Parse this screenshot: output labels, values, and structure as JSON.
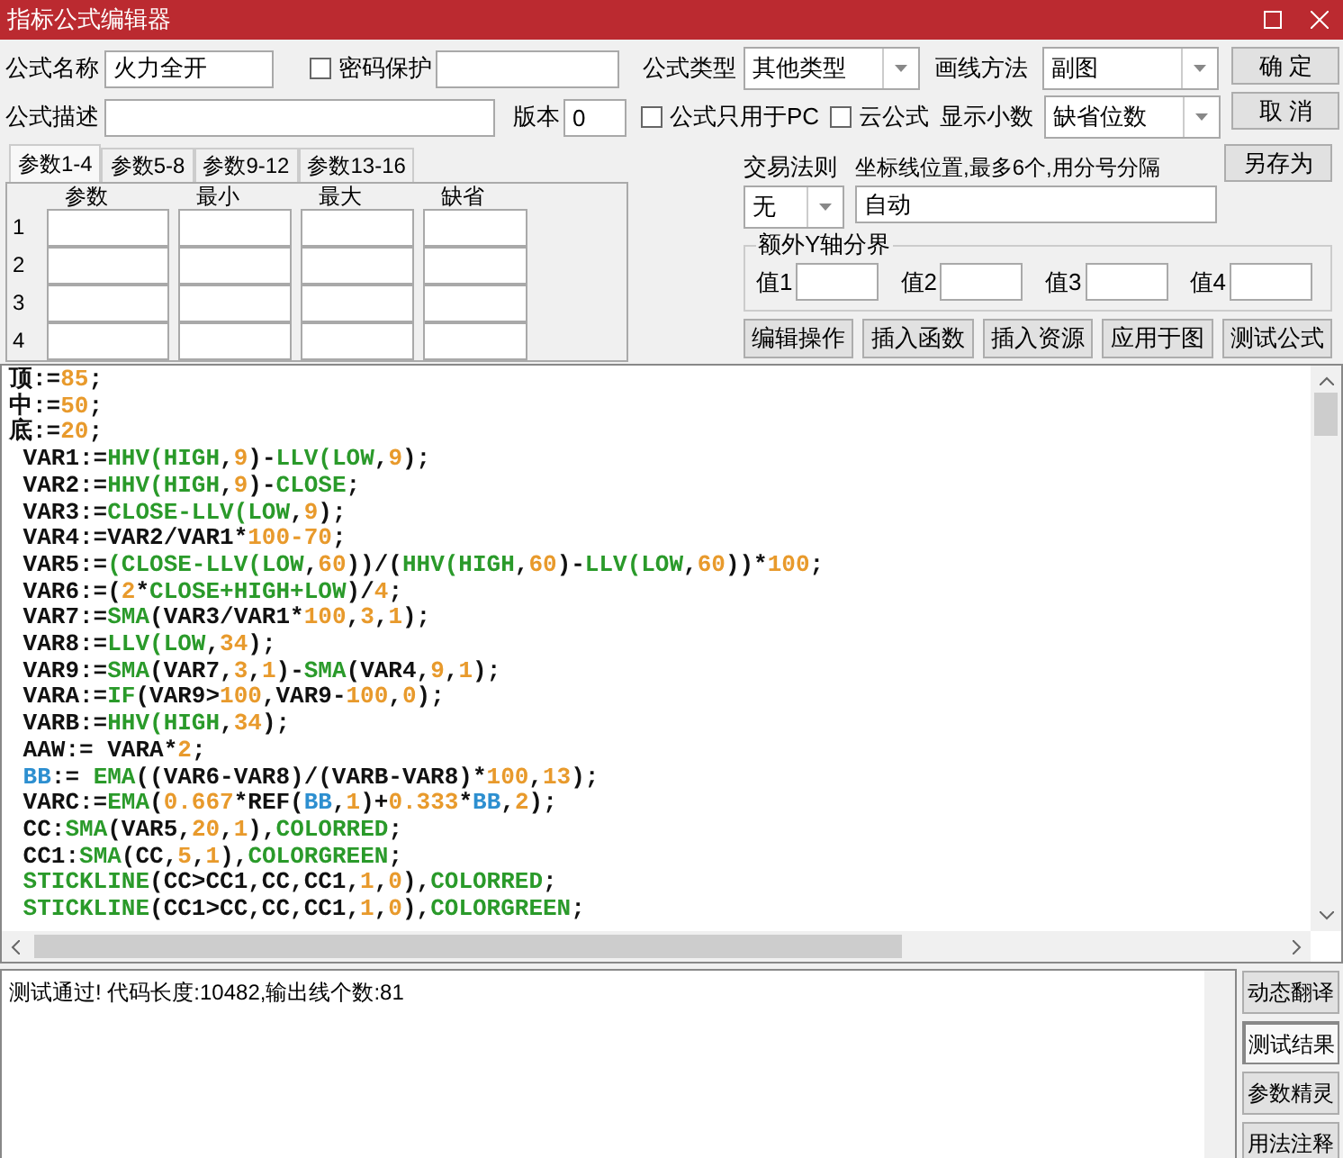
{
  "window": {
    "title": "指标公式编辑器"
  },
  "form": {
    "name_label": "公式名称",
    "name_value": "火力全开",
    "password": {
      "label": "密码保护",
      "checked": false
    },
    "type_label": "公式类型",
    "type_value": "其他类型",
    "draw_label": "画线方法",
    "draw_value": "副图",
    "desc_label": "公式描述",
    "version_label": "版本",
    "version_value": "0",
    "pc_only": {
      "label": "公式只用于PC",
      "checked": false
    },
    "cloud": {
      "label": "云公式",
      "checked": false
    },
    "decimals_label": "显示小数",
    "decimals_value": "缺省位数"
  },
  "buttons_right": [
    "确  定",
    "取  消",
    "另存为"
  ],
  "param_tabs": [
    {
      "label": "参数1-4",
      "selected": true
    },
    {
      "label": "参数5-8",
      "selected": false
    },
    {
      "label": "参数9-12",
      "selected": false
    },
    {
      "label": "参数13-16",
      "selected": false
    }
  ],
  "param_table": {
    "columns": [
      "参数",
      "最小",
      "最大",
      "缺省"
    ],
    "rows": [
      "1",
      "2",
      "3",
      "4"
    ]
  },
  "trade_rule": {
    "label": "交易法则",
    "value": "无"
  },
  "axis_lines": {
    "label": "坐标线位置,最多6个,用分号分隔",
    "value": "自动"
  },
  "extra_y": {
    "title": "额外Y轴分界",
    "fields": [
      "值1",
      "值2",
      "值3",
      "值4"
    ]
  },
  "action_buttons": [
    "编辑操作",
    "插入函数",
    "插入资源",
    "应用于图",
    "测试公式"
  ],
  "code_lines": [
    [
      {
        "kind": "plain",
        "text": "顶:="
      },
      {
        "kind": "num",
        "text": "85"
      },
      {
        "kind": "plain",
        "text": ";"
      }
    ],
    [
      {
        "kind": "plain",
        "text": "中:="
      },
      {
        "kind": "num",
        "text": "50"
      },
      {
        "kind": "plain",
        "text": ";"
      }
    ],
    [
      {
        "kind": "plain",
        "text": "底:="
      },
      {
        "kind": "num",
        "text": "20"
      },
      {
        "kind": "plain",
        "text": ";"
      }
    ],
    [
      {
        "kind": "plain",
        "text": " VAR1:="
      },
      {
        "kind": "fn",
        "text": "HHV(HIGH"
      },
      {
        "kind": "plain",
        "text": ","
      },
      {
        "kind": "num",
        "text": "9"
      },
      {
        "kind": "plain",
        "text": ")-"
      },
      {
        "kind": "fn",
        "text": "LLV(LOW"
      },
      {
        "kind": "plain",
        "text": ","
      },
      {
        "kind": "num",
        "text": "9"
      },
      {
        "kind": "plain",
        "text": ");"
      }
    ],
    [
      {
        "kind": "plain",
        "text": " VAR2:="
      },
      {
        "kind": "fn",
        "text": "HHV(HIGH"
      },
      {
        "kind": "plain",
        "text": ","
      },
      {
        "kind": "num",
        "text": "9"
      },
      {
        "kind": "plain",
        "text": ")-"
      },
      {
        "kind": "fn",
        "text": "CLOSE"
      },
      {
        "kind": "plain",
        "text": ";"
      }
    ],
    [
      {
        "kind": "plain",
        "text": " VAR3:="
      },
      {
        "kind": "fn",
        "text": "CLOSE-LLV(LOW"
      },
      {
        "kind": "plain",
        "text": ","
      },
      {
        "kind": "num",
        "text": "9"
      },
      {
        "kind": "plain",
        "text": ");"
      }
    ],
    [
      {
        "kind": "plain",
        "text": " VAR4:=VAR2/VAR1*"
      },
      {
        "kind": "num",
        "text": "100-70"
      },
      {
        "kind": "plain",
        "text": ";"
      }
    ],
    [
      {
        "kind": "plain",
        "text": " VAR5:="
      },
      {
        "kind": "fn",
        "text": "(CLOSE-LLV(LOW"
      },
      {
        "kind": "plain",
        "text": ","
      },
      {
        "kind": "num",
        "text": "60"
      },
      {
        "kind": "plain",
        "text": "))/("
      },
      {
        "kind": "fn",
        "text": "HHV(HIGH"
      },
      {
        "kind": "plain",
        "text": ","
      },
      {
        "kind": "num",
        "text": "60"
      },
      {
        "kind": "plain",
        "text": ")-"
      },
      {
        "kind": "fn",
        "text": "LLV(LOW"
      },
      {
        "kind": "plain",
        "text": ","
      },
      {
        "kind": "num",
        "text": "60"
      },
      {
        "kind": "plain",
        "text": "))*"
      },
      {
        "kind": "num",
        "text": "100"
      },
      {
        "kind": "plain",
        "text": ";"
      }
    ],
    [
      {
        "kind": "plain",
        "text": " VAR6:=("
      },
      {
        "kind": "num",
        "text": "2"
      },
      {
        "kind": "plain",
        "text": "*"
      },
      {
        "kind": "fn",
        "text": "CLOSE+HIGH+LOW"
      },
      {
        "kind": "plain",
        "text": ")/"
      },
      {
        "kind": "num",
        "text": "4"
      },
      {
        "kind": "plain",
        "text": ";"
      }
    ],
    [
      {
        "kind": "plain",
        "text": " VAR7:="
      },
      {
        "kind": "fn",
        "text": "SMA"
      },
      {
        "kind": "plain",
        "text": "(VAR3/VAR1*"
      },
      {
        "kind": "num",
        "text": "100"
      },
      {
        "kind": "plain",
        "text": ","
      },
      {
        "kind": "num",
        "text": "3"
      },
      {
        "kind": "plain",
        "text": ","
      },
      {
        "kind": "num",
        "text": "1"
      },
      {
        "kind": "plain",
        "text": ");"
      }
    ],
    [
      {
        "kind": "plain",
        "text": " VAR8:="
      },
      {
        "kind": "fn",
        "text": "LLV(LOW"
      },
      {
        "kind": "plain",
        "text": ","
      },
      {
        "kind": "num",
        "text": "34"
      },
      {
        "kind": "plain",
        "text": ");"
      }
    ],
    [
      {
        "kind": "plain",
        "text": " VAR9:="
      },
      {
        "kind": "fn",
        "text": "SMA"
      },
      {
        "kind": "plain",
        "text": "(VAR7,"
      },
      {
        "kind": "num",
        "text": "3"
      },
      {
        "kind": "plain",
        "text": ","
      },
      {
        "kind": "num",
        "text": "1"
      },
      {
        "kind": "plain",
        "text": ")-"
      },
      {
        "kind": "fn",
        "text": "SMA"
      },
      {
        "kind": "plain",
        "text": "(VAR4,"
      },
      {
        "kind": "num",
        "text": "9"
      },
      {
        "kind": "plain",
        "text": ","
      },
      {
        "kind": "num",
        "text": "1"
      },
      {
        "kind": "plain",
        "text": ");"
      }
    ],
    [
      {
        "kind": "plain",
        "text": " VARA:="
      },
      {
        "kind": "fn",
        "text": "IF"
      },
      {
        "kind": "plain",
        "text": "(VAR9>"
      },
      {
        "kind": "num",
        "text": "100"
      },
      {
        "kind": "plain",
        "text": ",VAR9-"
      },
      {
        "kind": "num",
        "text": "100"
      },
      {
        "kind": "plain",
        "text": ","
      },
      {
        "kind": "num",
        "text": "0"
      },
      {
        "kind": "plain",
        "text": ");"
      }
    ],
    [
      {
        "kind": "plain",
        "text": " VARB:="
      },
      {
        "kind": "fn",
        "text": "HHV(HIGH"
      },
      {
        "kind": "plain",
        "text": ","
      },
      {
        "kind": "num",
        "text": "34"
      },
      {
        "kind": "plain",
        "text": ");"
      }
    ],
    [
      {
        "kind": "plain",
        "text": " AAW:= VARA*"
      },
      {
        "kind": "num",
        "text": "2"
      },
      {
        "kind": "plain",
        "text": ";"
      }
    ],
    [
      {
        "kind": "ref",
        "text": " BB"
      },
      {
        "kind": "plain",
        "text": ":= "
      },
      {
        "kind": "fn",
        "text": "EMA"
      },
      {
        "kind": "plain",
        "text": "((VAR6-VAR8)/(VARB-VAR8)*"
      },
      {
        "kind": "num",
        "text": "100"
      },
      {
        "kind": "plain",
        "text": ","
      },
      {
        "kind": "num",
        "text": "13"
      },
      {
        "kind": "plain",
        "text": ");"
      }
    ],
    [
      {
        "kind": "plain",
        "text": " VARC:="
      },
      {
        "kind": "fn",
        "text": "EMA"
      },
      {
        "kind": "plain",
        "text": "("
      },
      {
        "kind": "num",
        "text": "0.667"
      },
      {
        "kind": "plain",
        "text": "*REF("
      },
      {
        "kind": "ref",
        "text": "BB"
      },
      {
        "kind": "plain",
        "text": ","
      },
      {
        "kind": "num",
        "text": "1"
      },
      {
        "kind": "plain",
        "text": ")+"
      },
      {
        "kind": "num",
        "text": "0.333"
      },
      {
        "kind": "plain",
        "text": "*"
      },
      {
        "kind": "ref",
        "text": "BB"
      },
      {
        "kind": "plain",
        "text": ","
      },
      {
        "kind": "num",
        "text": "2"
      },
      {
        "kind": "plain",
        "text": ");"
      }
    ],
    [
      {
        "kind": "plain",
        "text": " CC:"
      },
      {
        "kind": "fn",
        "text": "SMA"
      },
      {
        "kind": "plain",
        "text": "(VAR5,"
      },
      {
        "kind": "num",
        "text": "20"
      },
      {
        "kind": "plain",
        "text": ","
      },
      {
        "kind": "num",
        "text": "1"
      },
      {
        "kind": "plain",
        "text": "),"
      },
      {
        "kind": "fn",
        "text": "COLORRED"
      },
      {
        "kind": "plain",
        "text": ";"
      }
    ],
    [
      {
        "kind": "plain",
        "text": " CC1:"
      },
      {
        "kind": "fn",
        "text": "SMA"
      },
      {
        "kind": "plain",
        "text": "(CC,"
      },
      {
        "kind": "num",
        "text": "5"
      },
      {
        "kind": "plain",
        "text": ","
      },
      {
        "kind": "num",
        "text": "1"
      },
      {
        "kind": "plain",
        "text": "),"
      },
      {
        "kind": "fn",
        "text": "COLORGREEN"
      },
      {
        "kind": "plain",
        "text": ";"
      }
    ],
    [
      {
        "kind": "fn",
        "text": " STICKLINE"
      },
      {
        "kind": "plain",
        "text": "(CC>CC1,CC,CC1,"
      },
      {
        "kind": "num",
        "text": "1"
      },
      {
        "kind": "plain",
        "text": ","
      },
      {
        "kind": "num",
        "text": "0"
      },
      {
        "kind": "plain",
        "text": "),"
      },
      {
        "kind": "fn",
        "text": "COLORRED"
      },
      {
        "kind": "plain",
        "text": ";"
      }
    ],
    [
      {
        "kind": "fn",
        "text": " STICKLINE"
      },
      {
        "kind": "plain",
        "text": "(CC1>CC,CC,CC1,"
      },
      {
        "kind": "num",
        "text": "1"
      },
      {
        "kind": "plain",
        "text": ","
      },
      {
        "kind": "num",
        "text": "0"
      },
      {
        "kind": "plain",
        "text": "),"
      },
      {
        "kind": "fn",
        "text": "COLORGREEN"
      },
      {
        "kind": "plain",
        "text": ";"
      }
    ]
  ],
  "output": {
    "text": "测试通过! 代码长度:10482,输出线个数:81"
  },
  "side_buttons": [
    {
      "label": "动态翻译",
      "selected": false
    },
    {
      "label": "测试结果",
      "selected": true
    },
    {
      "label": "参数精灵",
      "selected": false
    },
    {
      "label": "用法注释",
      "selected": false
    }
  ]
}
